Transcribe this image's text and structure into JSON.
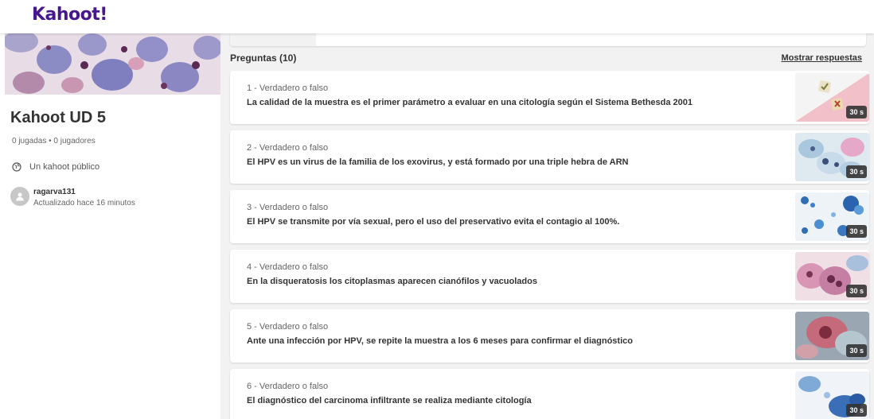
{
  "app": {
    "logo": "Kahoot!"
  },
  "sidebar": {
    "title": "Kahoot UD 5",
    "stats": "0 jugadas • 0 jugadores",
    "visibility": "Un kahoot público",
    "visibility_icon": "globe-icon",
    "author": {
      "name": "ragarva131",
      "updated": "Actualizado hace 16 minutos"
    }
  },
  "main": {
    "heading": "Preguntas (10)",
    "show_answers": "Mostrar respuestas",
    "questions": [
      {
        "meta": "1 - Verdadero o falso",
        "text": "La calidad de la muestra es el primer parámetro a evaluar en una citología según el Sistema Bethesda 2001",
        "time": "30 s"
      },
      {
        "meta": "2 - Verdadero o falso",
        "text": "El HPV es un virus de la familia de los exovirus, y está formado por una triple hebra de ARN",
        "time": "30 s"
      },
      {
        "meta": "3 - Verdadero o falso",
        "text": "El HPV se transmite por vía sexual, pero el uso del preservativo evita el contagio al 100%.",
        "time": "30 s"
      },
      {
        "meta": "4 - Verdadero o falso",
        "text": "En la disqueratosis los citoplasmas aparecen cianófilos y vacuolados",
        "time": "30 s"
      },
      {
        "meta": "5 - Verdadero o falso",
        "text": "Ante una infección por HPV, se repite la muestra a los 6 meses para confirmar el diagnóstico",
        "time": "30 s"
      },
      {
        "meta": "6 - Verdadero o falso",
        "text": "El diagnóstico del carcinoma infiltrante se realiza mediante citología",
        "time": "30 s"
      }
    ]
  },
  "colors": {
    "brand": "#46178f",
    "background": "#f2f2f2",
    "card": "#ffffff",
    "badge": "#333333"
  }
}
